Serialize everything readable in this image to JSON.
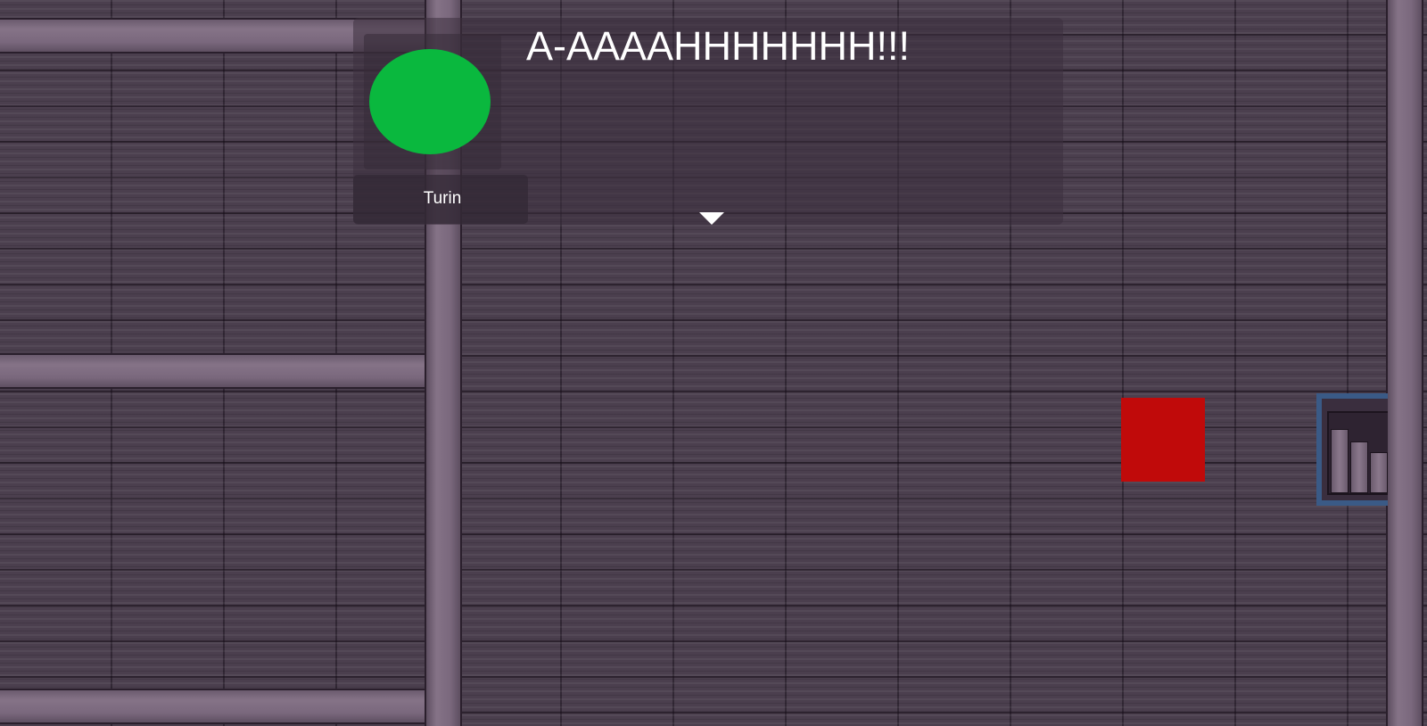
{
  "dialog": {
    "speaker": "Turin",
    "text": "A-AAAAHHHHHHH!!!",
    "portrait_color": "#0ab83e"
  },
  "scene": {
    "floor_color": "#4b3f4e",
    "beam_color": "#7a687d",
    "red_object_color": "#c00a0a",
    "shelf_border_color": "#3a5a86"
  },
  "icons": {
    "advance": "chevron-down-icon"
  }
}
